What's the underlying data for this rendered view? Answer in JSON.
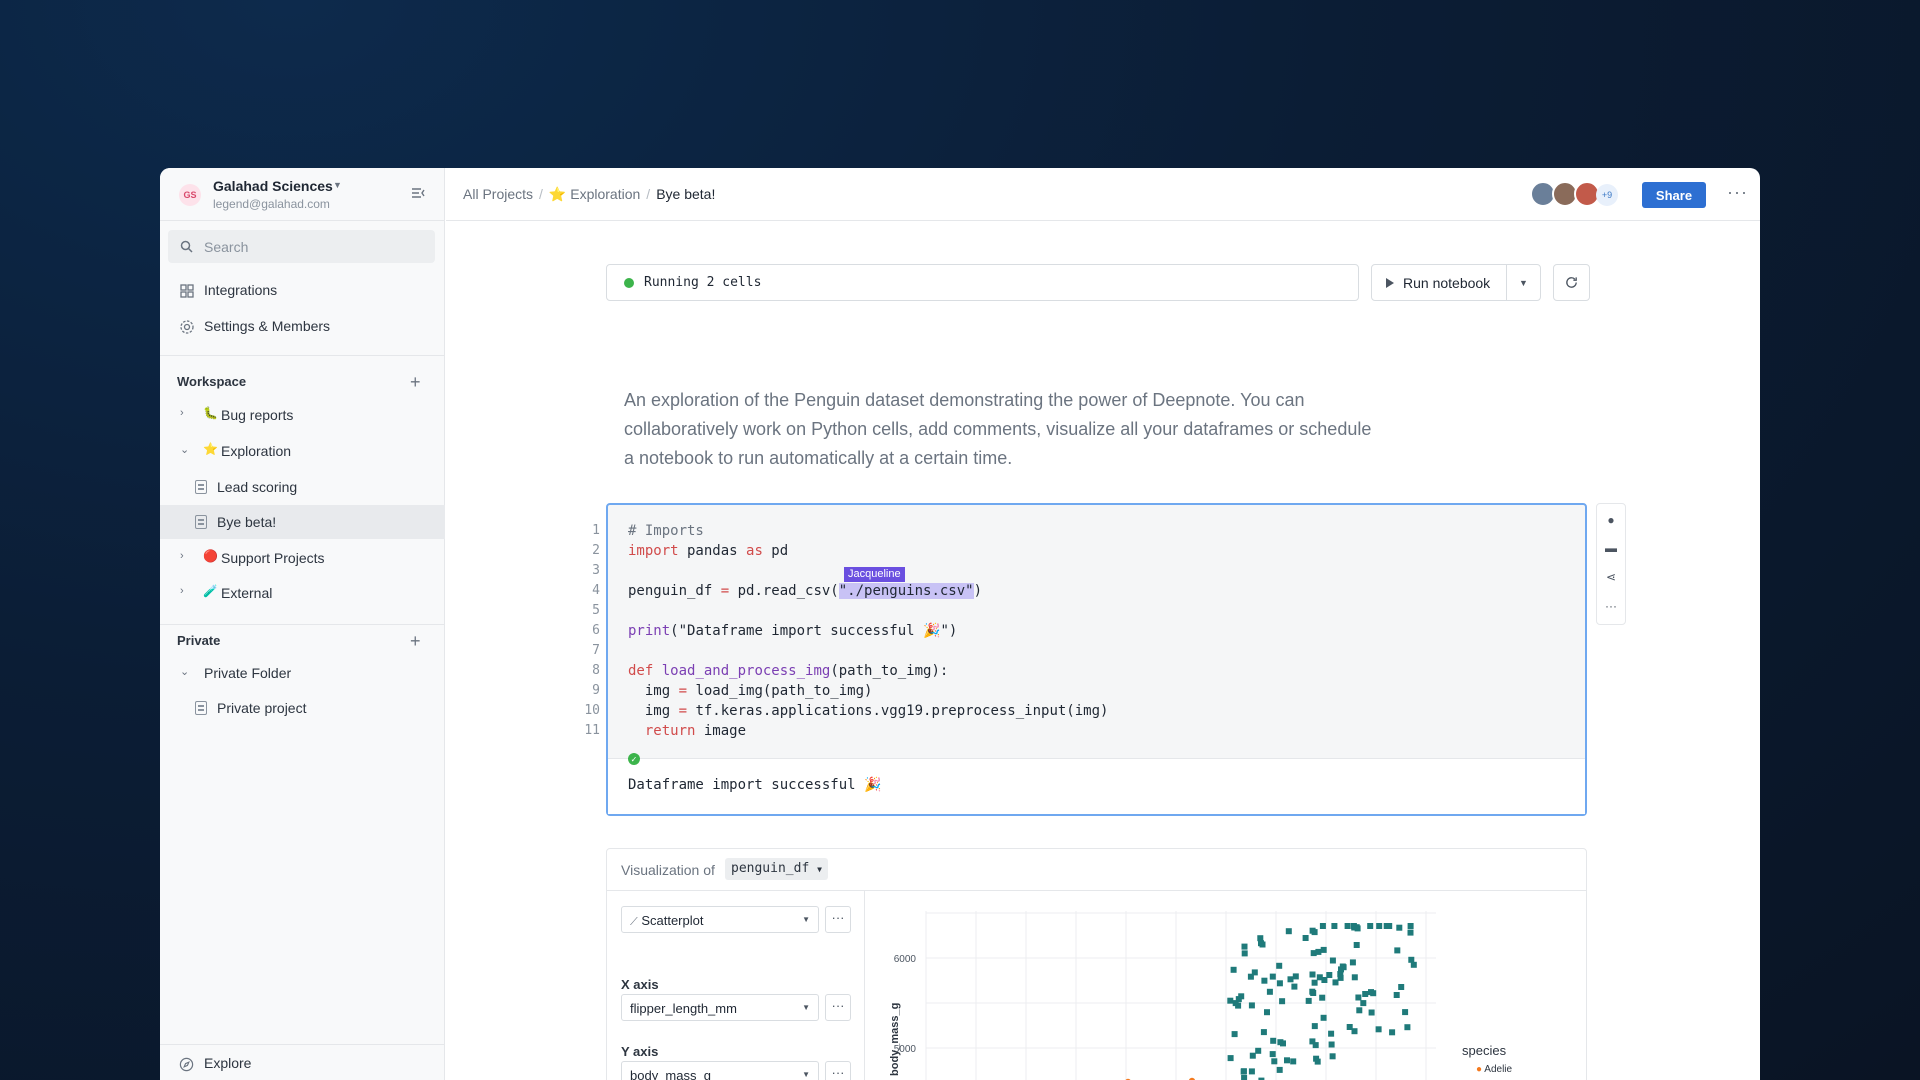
{
  "org": {
    "initials": "GS",
    "name": "Galahad Sciences",
    "email": "legend@galahad.com"
  },
  "search": {
    "placeholder": "Search"
  },
  "nav": {
    "integrations": "Integrations",
    "settings": "Settings & Members"
  },
  "workspace": {
    "title": "Workspace",
    "items": [
      {
        "emoji": "🐛",
        "label": "Bug reports"
      },
      {
        "emoji": "⭐",
        "label": "Exploration"
      },
      {
        "label": "Lead scoring"
      },
      {
        "label": "Bye beta!"
      },
      {
        "emoji": "🔴",
        "label": "Support Projects"
      },
      {
        "emoji": "🧪",
        "label": "External"
      }
    ]
  },
  "private": {
    "title": "Private",
    "items": [
      {
        "label": "Private Folder"
      },
      {
        "label": "Private project"
      }
    ]
  },
  "explore": "Explore",
  "breadcrumb": {
    "all": "All Projects",
    "folder_emoji": "⭐",
    "folder": "Exploration",
    "current": "Bye beta!"
  },
  "collaborators": {
    "extra": "+9"
  },
  "share": "Share",
  "run_status": "Running 2 cells",
  "run_button": "Run notebook",
  "intro": "An exploration of the Penguin dataset demonstrating the power of Deepnote. You can collaboratively work on Python cells, add comments, visualize all your dataframes or schedule a notebook to run automatically at a certain time.",
  "cursor_user": "Jacqueline",
  "output": "Dataframe import successful 🎉",
  "viz": {
    "label": "Visualization of",
    "dataframe": "penguin_df",
    "chart_type": "Scatterplot",
    "x_axis_label": "X axis",
    "x_axis": "flipper_length_mm",
    "y_axis_label": "Y axis",
    "y_axis": "body_mass_g",
    "legend_title": "species",
    "legend_first": "Adelie"
  },
  "chart_data": {
    "type": "scatter",
    "ylabel": "body_mass_g",
    "yticks": [
      "6000",
      "5000"
    ],
    "legend": "species",
    "series": [
      {
        "name": "Adelie",
        "color": "#f47a1f"
      },
      {
        "color": "#1f7a7a"
      }
    ]
  }
}
